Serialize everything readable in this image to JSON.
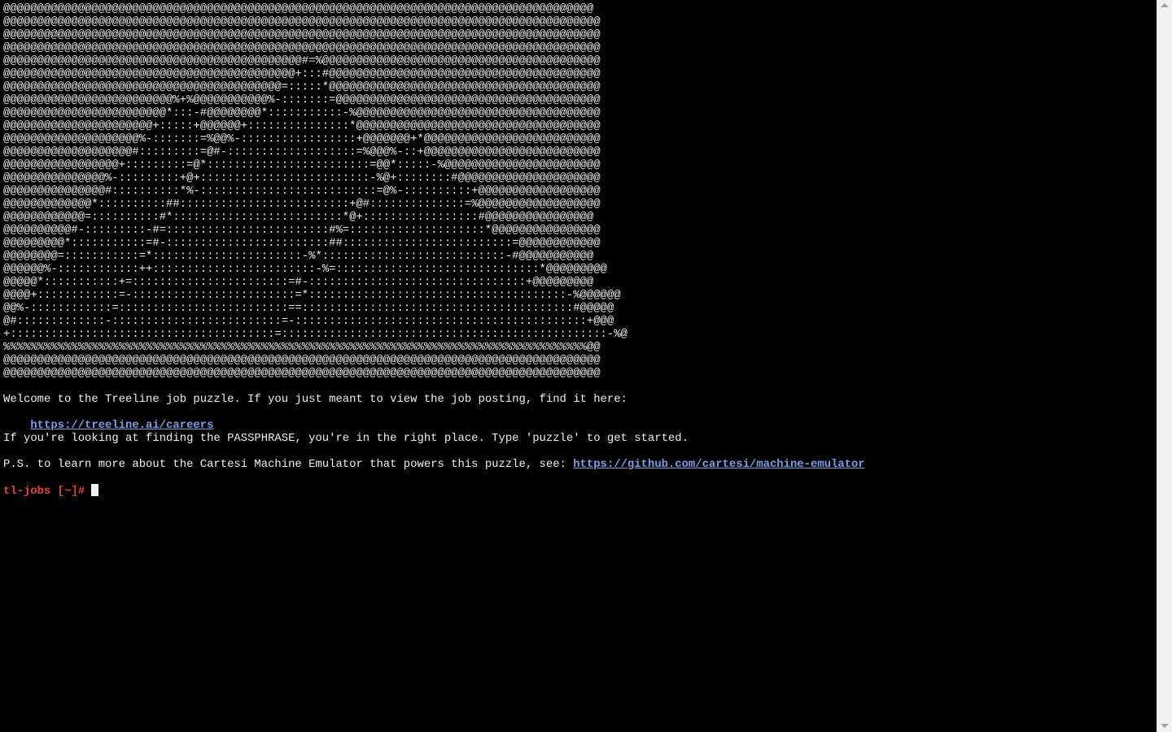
{
  "terminal": {
    "ascii_art": [
      "@@@@@@@@@@@@@@@@@@@@@@@@@@@@@@@@@@@@@@@@@@@@@@@@@@@@@@@@@@@@@@@@@@@@@@@@@@@@@@@@@@@@@@@",
      "@@@@@@@@@@@@@@@@@@@@@@@@@@@@@@@@@@@@@@@@@@@@@@@@@@@@@@@@@@@@@@@@@@@@@@@@@@@@@@@@@@@@@@@@",
      "@@@@@@@@@@@@@@@@@@@@@@@@@@@@@@@@@@@@@@@@@@@@@@@@@@@@@@@@@@@@@@@@@@@@@@@@@@@@@@@@@@@@@@@@",
      "@@@@@@@@@@@@@@@@@@@@@@@@@@@@@@@@@@@@@@@@@@@@@@@@@@@@@@@@@@@@@@@@@@@@@@@@@@@@@@@@@@@@@@@@",
      "@@@@@@@@@@@@@@@@@@@@@@@@@@@@@@@@@@@@@@@@@@@@#=%@@@@@@@@@@@@@@@@@@@@@@@@@@@@@@@@@@@@@@@@@",
      "@@@@@@@@@@@@@@@@@@@@@@@@@@@@@@@@@@@@@@@@@@@+:::#@@@@@@@@@@@@@@@@@@@@@@@@@@@@@@@@@@@@@@@@",
      "@@@@@@@@@@@@@@@@@@@@@@@@@@@@@@@@@@@@@@@@@=:::::*@@@@@@@@@@@@@@@@@@@@@@@@@@@@@@@@@@@@@@@@",
      "@@@@@@@@@@@@@@@@@@@@@@@@@%+%@@@@@@@@@@@%-:::::::=@@@@@@@@@@@@@@@@@@@@@@@@@@@@@@@@@@@@@@@",
      "@@@@@@@@@@@@@@@@@@@@@@@@*:::-#@@@@@@@@*:::::::::::-%@@@@@@@@@@@@@@@@@@@@@@@@@@@@@@@@@@@@",
      "@@@@@@@@@@@@@@@@@@@@@@+:::::+@@@@@@+:::::::::::::::*@@@@@@@@@@@@@@@@@@@@@@@@@@@@@@@@@@@@",
      "@@@@@@@@@@@@@@@@@@@@%-:::::::=%@@%-:::::::::::::::::+@@@@@@@+*@@@@@@@@@@@@@@@@@@@@@@@@@@",
      "@@@@@@@@@@@@@@@@@@@#:::::::::=@#-:::::::::::::::::::=%@@@%-::+@@@@@@@@@@@@@@@@@@@@@@@@@@",
      "@@@@@@@@@@@@@@@@@+:::::::::=@*::::::::::::::::::::::::=@@*:::::-%@@@@@@@@@@@@@@@@@@@@@@@",
      "@@@@@@@@@@@@@@@%-:::::::::+@+:::::::::::::::::::::::::-%@+::::::::#@@@@@@@@@@@@@@@@@@@@@",
      "@@@@@@@@@@@@@@@#::::::::::*%-::::::::::::::::::::::::::=@%-::::::::::+@@@@@@@@@@@@@@@@@@",
      "@@@@@@@@@@@@@*::::::::::##:::::::::::::::::::::::::+@#::::::::::::::=%@@@@@@@@@@@@@@@@@@",
      "@@@@@@@@@@@@=::::::::::#*:::::::::::::::::::::::::*@+:::::::::::::::::#@@@@@@@@@@@@@@@@",
      "@@@@@@@@@@#-:::::::::-#=::::::::::::::::::::::::#%=::::::::::::::::::::*@@@@@@@@@@@@@@@@",
      "@@@@@@@@@*:::::::::::=#-::::::::::::::::::::::::##:::::::::::::::::::::::::=@@@@@@@@@@@@",
      "@@@@@@@@=:::::::::::=*::::::::::::::::::::::-%*:::::::::::::::::::::::::::-#@@@@@@@@@@@",
      "@@@@@@%-::::::::::::++::::::::::::::::::::::::-%=::::::::::::::::::::::::::::::*@@@@@@@@@",
      "@@@@@*:::::::::::+=:::::::::::::::::::::::=#-::::::::::::::::::::::::::::::::+@@@@@@@@@",
      "@@@@+::::::::::::=-::::::::::::::::::::::::=*::::::::::::::::::::::::::::::::::::::-%@@@@@@",
      "@@%-::::::::::::=:::::::::::::::::::::::::==::::::::::::::::::::::::::::::::::::::::#@@@@@",
      "@#:::::::::::::-:::::::::::::::::::::::::=-:::::::::::::::::::::::::::::::::::::::::::+@@@",
      "+:::::::::::::::::::::::::::::::::::::::=::::::::::::::::::::::::::::::::::::::::::::::::-%@",
      "%%%%%%%%%%%%%%%%%%%%%%%%%%%%%%%%%%%%%%%%%%%%%%%%%%%%%%%%%%%%%%%%%%%%%%%%%%%%%%%%%%%%%%@@",
      "@@@@@@@@@@@@@@@@@@@@@@@@@@@@@@@@@@@@@@@@@@@@@@@@@@@@@@@@@@@@@@@@@@@@@@@@@@@@@@@@@@@@@@@@",
      "@@@@@@@@@@@@@@@@@@@@@@@@@@@@@@@@@@@@@@@@@@@@@@@@@@@@@@@@@@@@@@@@@@@@@@@@@@@@@@@@@@@@@@@@"
    ],
    "welcome_text": "Welcome to the Treeline job puzzle. If you just meant to view the job posting, find it here:",
    "careers_link": "https://treeline.ai/careers",
    "passphrase_text": "If you're looking at finding the PASSPHRASE, you're in the right place. Type 'puzzle' to get started.",
    "ps_text": "P.S. to learn more about the Cartesi Machine Emulator that powers this puzzle, see: ",
    "emulator_link": "https://github.com/cartesi/machine-emulator",
    "prompt": "tl-jobs [~]#",
    "colors": {
      "background": "#000000",
      "text": "#f0f0f0",
      "link": "#7aa0e6",
      "prompt": "#e8413a"
    }
  }
}
